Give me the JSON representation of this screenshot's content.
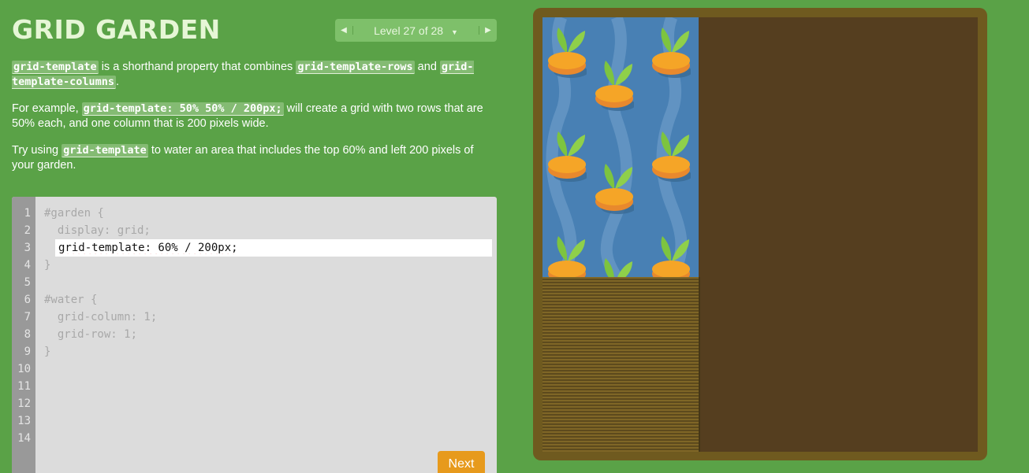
{
  "app": {
    "title": "GRID GARDEN"
  },
  "level_nav": {
    "prev_icon": "◀",
    "next_icon": "▶",
    "label": "Level 27 of 28",
    "dropdown_icon": "▼"
  },
  "instructions": {
    "p1": {
      "code1": "grid-template",
      "text1": " is a shorthand property that combines ",
      "code2": "grid-template-rows",
      "text2": " and ",
      "code3": "grid-template-columns",
      "text3": "."
    },
    "p2": {
      "text1": "For example, ",
      "code1": "grid-template: 50% 50% / 200px;",
      "text2": " will create a grid with two rows that are 50% each, and one column that is 200 pixels wide."
    },
    "p3": {
      "text1": "Try using ",
      "code1": "grid-template",
      "text2": " to water an area that includes the top 60% and left 200 pixels of your garden."
    }
  },
  "editor": {
    "line_numbers": [
      "1",
      "2",
      "3",
      "4",
      "5",
      "6",
      "7",
      "8",
      "9",
      "10",
      "11",
      "12",
      "13",
      "14"
    ],
    "lines": {
      "l1": "#garden {",
      "l2": "  display: grid;",
      "l4": "}",
      "l6": "#water {",
      "l7": "  grid-column: 1;",
      "l8": "  grid-row: 1;",
      "l9": "}"
    },
    "input_value": "grid-template: 60% / 200px;",
    "next_label": "Next"
  },
  "colors": {
    "background": "#5aa247",
    "accent": "#e79a1c",
    "water": "#4880b4",
    "soil": "#553e1f",
    "frame": "#6f5a1f"
  }
}
